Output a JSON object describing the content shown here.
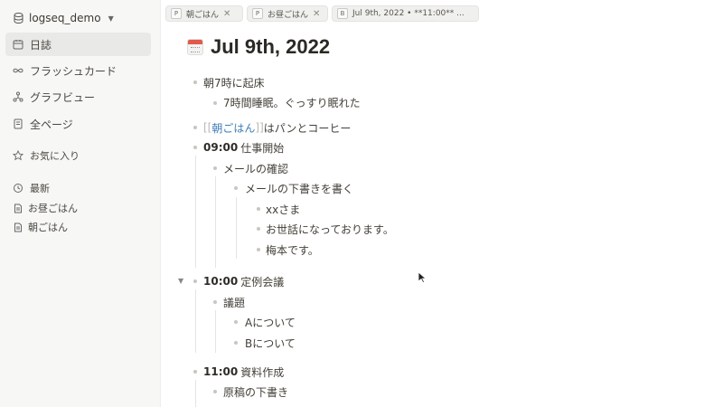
{
  "sidebar": {
    "graph_name": "logseq_demo",
    "nav": [
      {
        "label": "日誌",
        "icon": "calendar-icon"
      },
      {
        "label": "フラッシュカード",
        "icon": "infinity-icon"
      },
      {
        "label": "グラフビュー",
        "icon": "graph-icon"
      },
      {
        "label": "全ページ",
        "icon": "pages-icon"
      }
    ],
    "favorites_label": "お気に入り",
    "recent_label": "最新",
    "recent": [
      "お昼ごはん",
      "朝ごはん"
    ]
  },
  "tabs": [
    {
      "type": "P",
      "label": "朝ごはん"
    },
    {
      "type": "P",
      "label": "お昼ごはん"
    },
    {
      "type": "B",
      "label": "Jul 9th, 2022 • **11:00** ..."
    }
  ],
  "page": {
    "title": "Jul 9th, 2022",
    "blocks": {
      "b1": "朝7時に起床",
      "b1a": "7時間睡眠。ぐっすり眠れた",
      "b2_open": "[[",
      "b2_ref": "朝ごはん",
      "b2_close": "]]",
      "b2_text": " はパンとコーヒー",
      "b3_time": "09:00",
      "b3_text": "仕事開始",
      "b3a": "メールの確認",
      "b3b": "メールの下書きを書く",
      "b3b1": "xxさま",
      "b3b2": "お世話になっております。",
      "b3b3": "梅本です。",
      "b4_time": "10:00",
      "b4_text": "定例会議",
      "b4a": "議題",
      "b4a1": "Aについて",
      "b4a2": "Bについて",
      "b5_time": "11:00",
      "b5_text": "資料作成",
      "b5a": "原稿の下書き"
    }
  }
}
